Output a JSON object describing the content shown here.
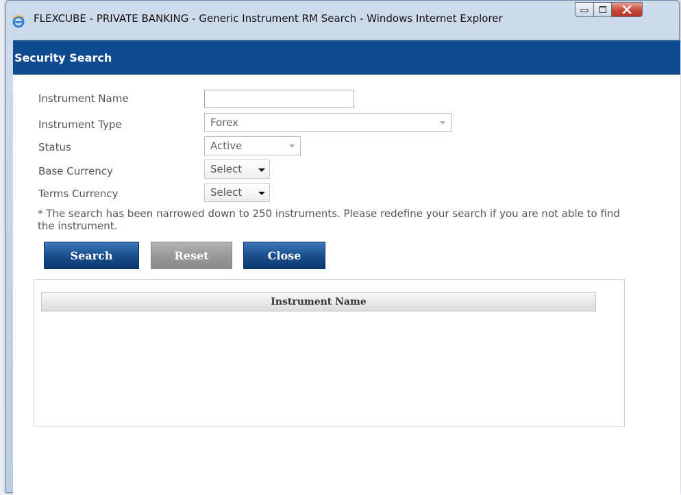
{
  "window": {
    "title": "FLEXCUBE - PRIVATE BANKING - Generic Instrument RM Search - Windows Internet Explorer",
    "icon": "ie-icon",
    "controls": [
      "minimize-icon",
      "maximize-icon",
      "close-icon"
    ]
  },
  "panel": {
    "title": "Security Search",
    "header_color": "#0f4b8e"
  },
  "form": {
    "instrument_name": {
      "label": "Instrument Name",
      "value": ""
    },
    "instrument_type": {
      "label": "Instrument Type",
      "value": "Forex"
    },
    "status": {
      "label": "Status",
      "value": "Active"
    },
    "base_currency": {
      "label": "Base Currency",
      "value": "Select"
    },
    "terms_currency": {
      "label": "Terms Currency",
      "value": "Select"
    }
  },
  "note": "* The search has been narrowed down to 250 instruments. Please redefine your search if you are not able to find the instrument.",
  "buttons": {
    "search": "Search",
    "reset": "Reset",
    "close": "Close"
  },
  "results": {
    "columns": [
      "Instrument Name"
    ],
    "rows": []
  }
}
